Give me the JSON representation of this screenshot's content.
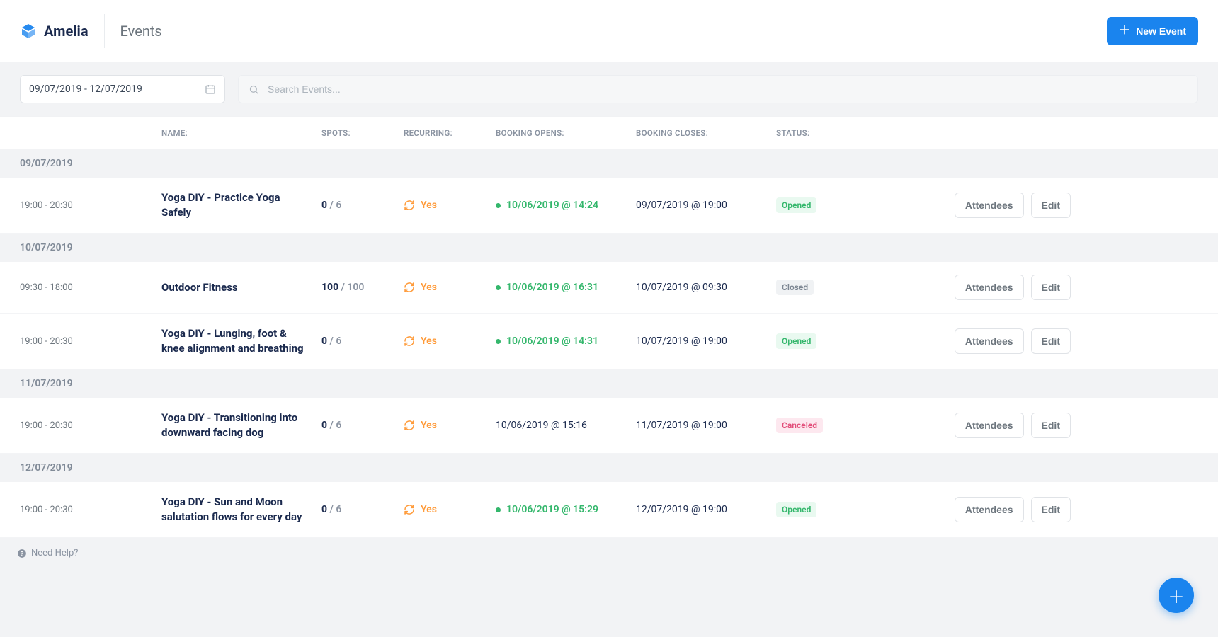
{
  "brand": {
    "name": "Amelia"
  },
  "header": {
    "title": "Events",
    "new_event_label": "New Event"
  },
  "filters": {
    "date_range": "09/07/2019 - 12/07/2019",
    "search_placeholder": "Search Events..."
  },
  "columns": {
    "name": "NAME:",
    "spots": "SPOTS:",
    "recurring": "RECURRING:",
    "booking_opens": "BOOKING OPENS:",
    "booking_closes": "BOOKING CLOSES:",
    "status": "STATUS:"
  },
  "row_actions": {
    "attendees": "Attendees",
    "edit": "Edit"
  },
  "recurring_label": "Yes",
  "statuses": {
    "opened": "Opened",
    "closed": "Closed",
    "canceled": "Canceled"
  },
  "groups": [
    {
      "date": "09/07/2019",
      "rows": [
        {
          "time": "19:00 - 20:30",
          "name": "Yoga DIY - Practice Yoga Safely",
          "booked": "0",
          "capacity": "6",
          "recurring": true,
          "opens": "10/06/2019 @ 14:24",
          "opens_live": true,
          "closes": "09/07/2019 @ 19:00",
          "status": "opened"
        }
      ]
    },
    {
      "date": "10/07/2019",
      "rows": [
        {
          "time": "09:30 - 18:00",
          "name": "Outdoor Fitness",
          "booked": "100",
          "capacity": "100",
          "recurring": true,
          "opens": "10/06/2019 @ 16:31",
          "opens_live": true,
          "closes": "10/07/2019 @ 09:30",
          "status": "closed"
        },
        {
          "time": "19:00 - 20:30",
          "name": "Yoga DIY - Lunging, foot & knee alignment and breathing",
          "booked": "0",
          "capacity": "6",
          "recurring": true,
          "opens": "10/06/2019 @ 14:31",
          "opens_live": true,
          "closes": "10/07/2019 @ 19:00",
          "status": "opened"
        }
      ]
    },
    {
      "date": "11/07/2019",
      "rows": [
        {
          "time": "19:00 - 20:30",
          "name": "Yoga DIY - Transitioning into downward facing dog",
          "booked": "0",
          "capacity": "6",
          "recurring": true,
          "opens": "10/06/2019 @ 15:16",
          "opens_live": false,
          "closes": "11/07/2019 @ 19:00",
          "status": "canceled"
        }
      ]
    },
    {
      "date": "12/07/2019",
      "rows": [
        {
          "time": "19:00 - 20:30",
          "name": "Yoga DIY - Sun and Moon salutation flows for every day",
          "booked": "0",
          "capacity": "6",
          "recurring": true,
          "opens": "10/06/2019 @ 15:29",
          "opens_live": true,
          "closes": "12/07/2019 @ 19:00",
          "status": "opened"
        }
      ]
    }
  ],
  "footer": {
    "help": "Need Help?"
  },
  "colors": {
    "primary": "#1a84ee",
    "accent_orange": "#ff9b3a",
    "success": "#34b76c",
    "danger": "#e24d79"
  }
}
